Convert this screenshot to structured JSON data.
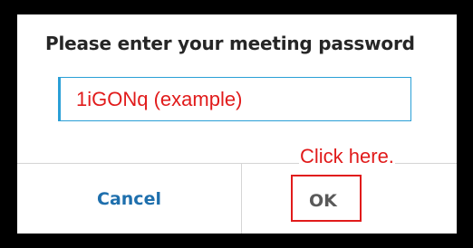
{
  "dialog": {
    "title": "Please enter your meeting password",
    "password_field": {
      "value": "",
      "placeholder": "1iGONq (example)"
    },
    "cancel_label": "Cancel",
    "ok_label": "OK"
  },
  "annotation": {
    "text": "Click here.",
    "color": "#e11b1b"
  },
  "colors": {
    "input_border": "#2a9fd6",
    "cancel_text": "#1e6fad",
    "ok_text": "#595959",
    "background": "#000000",
    "dialog_background": "#ffffff"
  }
}
